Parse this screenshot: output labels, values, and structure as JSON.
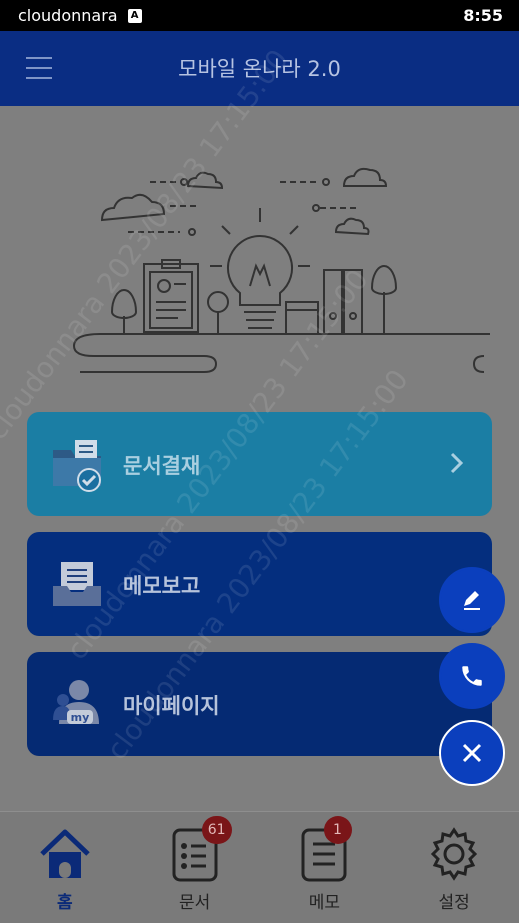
{
  "status_bar": {
    "app_name": "cloudonnara",
    "notification_badge": "A",
    "time": "8:55"
  },
  "header": {
    "title": "모바일 온나라 2.0",
    "menu_icon": "hamburger-menu-icon"
  },
  "cards": [
    {
      "label": "문서결재",
      "icon": "folder-check-icon",
      "color": "#1b7ea4"
    },
    {
      "label": "메모보고",
      "icon": "memo-tray-icon",
      "color": "#042e7e"
    },
    {
      "label": "마이페이지",
      "icon": "my-profile-icon",
      "color": "#052a73"
    }
  ],
  "fabs": [
    {
      "icon": "pencil-icon"
    },
    {
      "icon": "phone-icon"
    },
    {
      "icon": "close-icon"
    }
  ],
  "bottom_nav": [
    {
      "label": "홈",
      "icon": "home-icon",
      "active": true
    },
    {
      "label": "문서",
      "icon": "document-list-icon",
      "badge": "61"
    },
    {
      "label": "메모",
      "icon": "memo-icon",
      "badge": "1"
    },
    {
      "label": "설정",
      "icon": "gear-icon"
    }
  ],
  "watermark": "cloudonnara 2023/08/23 17:15:00",
  "colors": {
    "header_bg": "#0a2d83",
    "accent_blue": "#0b3fbd",
    "badge_red": "#7a1518"
  }
}
